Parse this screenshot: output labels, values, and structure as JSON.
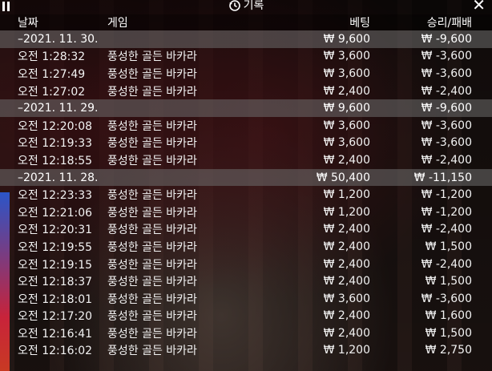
{
  "header": {
    "title": "기록",
    "close_label": "✕"
  },
  "columns": {
    "date": "날짜",
    "game": "게임",
    "bet": "베팅",
    "result": "승리/패배"
  },
  "groups": [
    {
      "date": "–2021. 11. 30.",
      "bet": "₩ 9,600",
      "result": "₩ -9,600",
      "rows": [
        {
          "time": "오전 1:28:32",
          "game": "풍성한 골든 바카라",
          "bet": "₩ 3,600",
          "result": "₩ -3,600"
        },
        {
          "time": "오전 1:27:49",
          "game": "풍성한 골든 바카라",
          "bet": "₩ 3,600",
          "result": "₩ -3,600"
        },
        {
          "time": "오전 1:27:02",
          "game": "풍성한 골든 바카라",
          "bet": "₩ 2,400",
          "result": "₩ -2,400"
        }
      ]
    },
    {
      "date": "–2021. 11. 29.",
      "bet": "₩ 9,600",
      "result": "₩ -9,600",
      "rows": [
        {
          "time": "오전 12:20:08",
          "game": "풍성한 골든 바카라",
          "bet": "₩ 3,600",
          "result": "₩ -3,600"
        },
        {
          "time": "오전 12:19:33",
          "game": "풍성한 골든 바카라",
          "bet": "₩ 3,600",
          "result": "₩ -3,600"
        },
        {
          "time": "오전 12:18:55",
          "game": "풍성한 골든 바카라",
          "bet": "₩ 2,400",
          "result": "₩ -2,400"
        }
      ]
    },
    {
      "date": "–2021. 11. 28.",
      "bet": "₩ 50,400",
      "result": "₩ -11,150",
      "rows": [
        {
          "time": "오전 12:23:33",
          "game": "풍성한 골든 바카라",
          "bet": "₩ 1,200",
          "result": "₩ -1,200"
        },
        {
          "time": "오전 12:21:06",
          "game": "풍성한 골든 바카라",
          "bet": "₩ 1,200",
          "result": "₩ -1,200"
        },
        {
          "time": "오전 12:20:31",
          "game": "풍성한 골든 바카라",
          "bet": "₩ 2,400",
          "result": "₩ -2,400"
        },
        {
          "time": "오전 12:19:55",
          "game": "풍성한 골든 바카라",
          "bet": "₩ 2,400",
          "result": "₩ 1,500"
        },
        {
          "time": "오전 12:19:15",
          "game": "풍성한 골든 바카라",
          "bet": "₩ 2,400",
          "result": "₩ -2,400"
        },
        {
          "time": "오전 12:18:37",
          "game": "풍성한 골든 바카라",
          "bet": "₩ 2,400",
          "result": "₩ 1,500"
        },
        {
          "time": "오전 12:18:01",
          "game": "풍성한 골든 바카라",
          "bet": "₩ 3,600",
          "result": "₩ -3,600"
        },
        {
          "time": "오전 12:17:20",
          "game": "풍성한 골든 바카라",
          "bet": "₩ 2,400",
          "result": "₩ 1,600"
        },
        {
          "time": "오전 12:16:41",
          "game": "풍성한 골든 바카라",
          "bet": "₩ 2,400",
          "result": "₩ 1,500"
        },
        {
          "time": "오전 12:16:02",
          "game": "풍성한 골든 바카라",
          "bet": "₩ 1,200",
          "result": "₩ 2,750"
        }
      ]
    }
  ]
}
